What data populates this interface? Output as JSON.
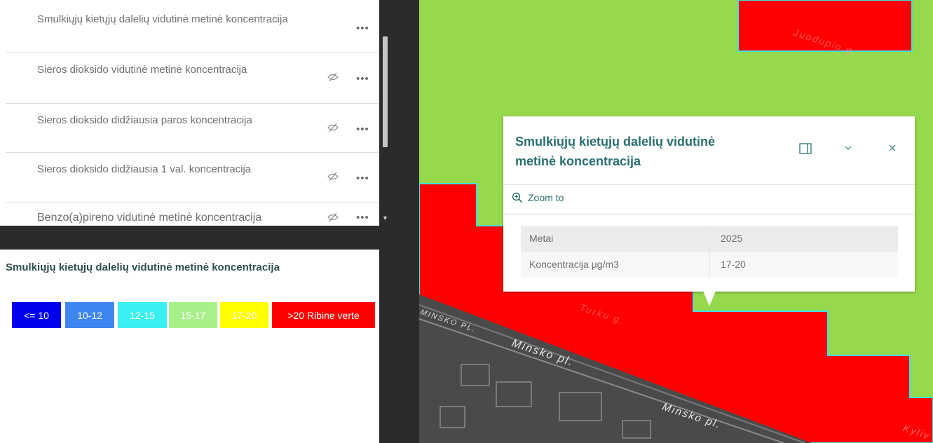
{
  "layers": [
    {
      "title": "Smulkiųjų kietųjų dalelių vidutinė metinė koncentracija",
      "visible": true
    },
    {
      "title": "Sieros dioksido vidutinė metinė koncentracija",
      "visible": false
    },
    {
      "title": "Sieros dioksido didžiausia paros koncentracija",
      "visible": false
    },
    {
      "title": "Sieros dioksido didžiausia 1 val. koncentracija",
      "visible": false
    },
    {
      "title": "Benzo(a)pireno vidutinė metinė koncentracija",
      "visible": false
    }
  ],
  "layer_actions_label": "•••",
  "visibility_icon": "eye-slash-icon",
  "legend": {
    "title": "Smulkiųjų kietųjų dalelių vidutinė metinė koncentracija",
    "classes": [
      {
        "label": "<= 10",
        "color": "#0000ee",
        "text_color": "#ffffff"
      },
      {
        "label": "10-12",
        "color": "#3f86f0",
        "text_color": "#ffffff"
      },
      {
        "label": "12-15",
        "color": "#3bf0f0",
        "text_color": "#ffffff"
      },
      {
        "label": "15-17",
        "color": "#a8f08a",
        "text_color": "#ffffff"
      },
      {
        "label": "17-20",
        "color": "#ffff00",
        "text_color": "#ffffff"
      },
      {
        "label": ">20 Ribine verte",
        "color": "#ff0000",
        "text_color": "#ffffff"
      }
    ]
  },
  "map": {
    "colors": {
      "green": "#96d94c",
      "red": "#ff0000",
      "cyan_outline": "#3fe0e0",
      "basemap": "#4a4a4a"
    },
    "street_labels": [
      "Juodupio g.",
      "Turku g.",
      "MINSKO PL.",
      "Minsko pl.",
      "Minsko pl.",
      "Kyliv"
    ]
  },
  "popup": {
    "title": "Smulkiųjų kietųjų dalelių vidutinė metinė koncentracija",
    "dock_icon": "dock-icon",
    "collapse_icon": "chevron-down-icon",
    "close_icon": "close-icon",
    "zoom_label": "Zoom to",
    "attributes": [
      {
        "key": "Metai",
        "value": "2025"
      },
      {
        "key": "Koncentracija µg/m3",
        "value": "17-20"
      }
    ]
  }
}
